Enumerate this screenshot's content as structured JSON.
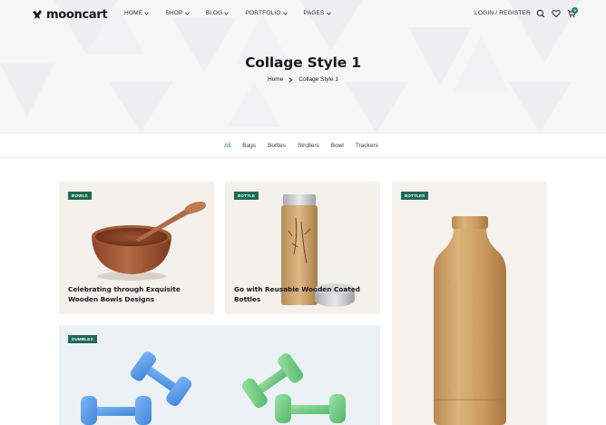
{
  "brand": {
    "name": "mooncart",
    "accent": "#1d7a5f"
  },
  "nav": {
    "items": [
      {
        "label": "HOME"
      },
      {
        "label": "SHOP"
      },
      {
        "label": "BLOG"
      },
      {
        "label": "PORTFOLIO"
      },
      {
        "label": "PAGES"
      }
    ],
    "login_label": "LOGIN / REGISTER",
    "cart_count": "0",
    "icons": [
      "search-icon",
      "heart-icon",
      "cart-icon"
    ]
  },
  "hero": {
    "title": "Collage Style 1",
    "breadcrumb": {
      "home": "Home",
      "current": "Collage Style 1"
    }
  },
  "filters": {
    "items": [
      "All",
      "Bags",
      "Bottles",
      "Strollers",
      "Bowl",
      "Trackers"
    ],
    "active": "All"
  },
  "cards": {
    "bowls": {
      "badge": "BOWLS",
      "title": "Celebrating through Exquisite Wooden Bowls Designs"
    },
    "bottle": {
      "badge": "BOTTLE",
      "title": "Go with Reusable Wooden Coated Bottles"
    },
    "bottles": {
      "badge": "BOTTLES"
    },
    "dumbles": {
      "badge": "DUMBLES"
    }
  }
}
